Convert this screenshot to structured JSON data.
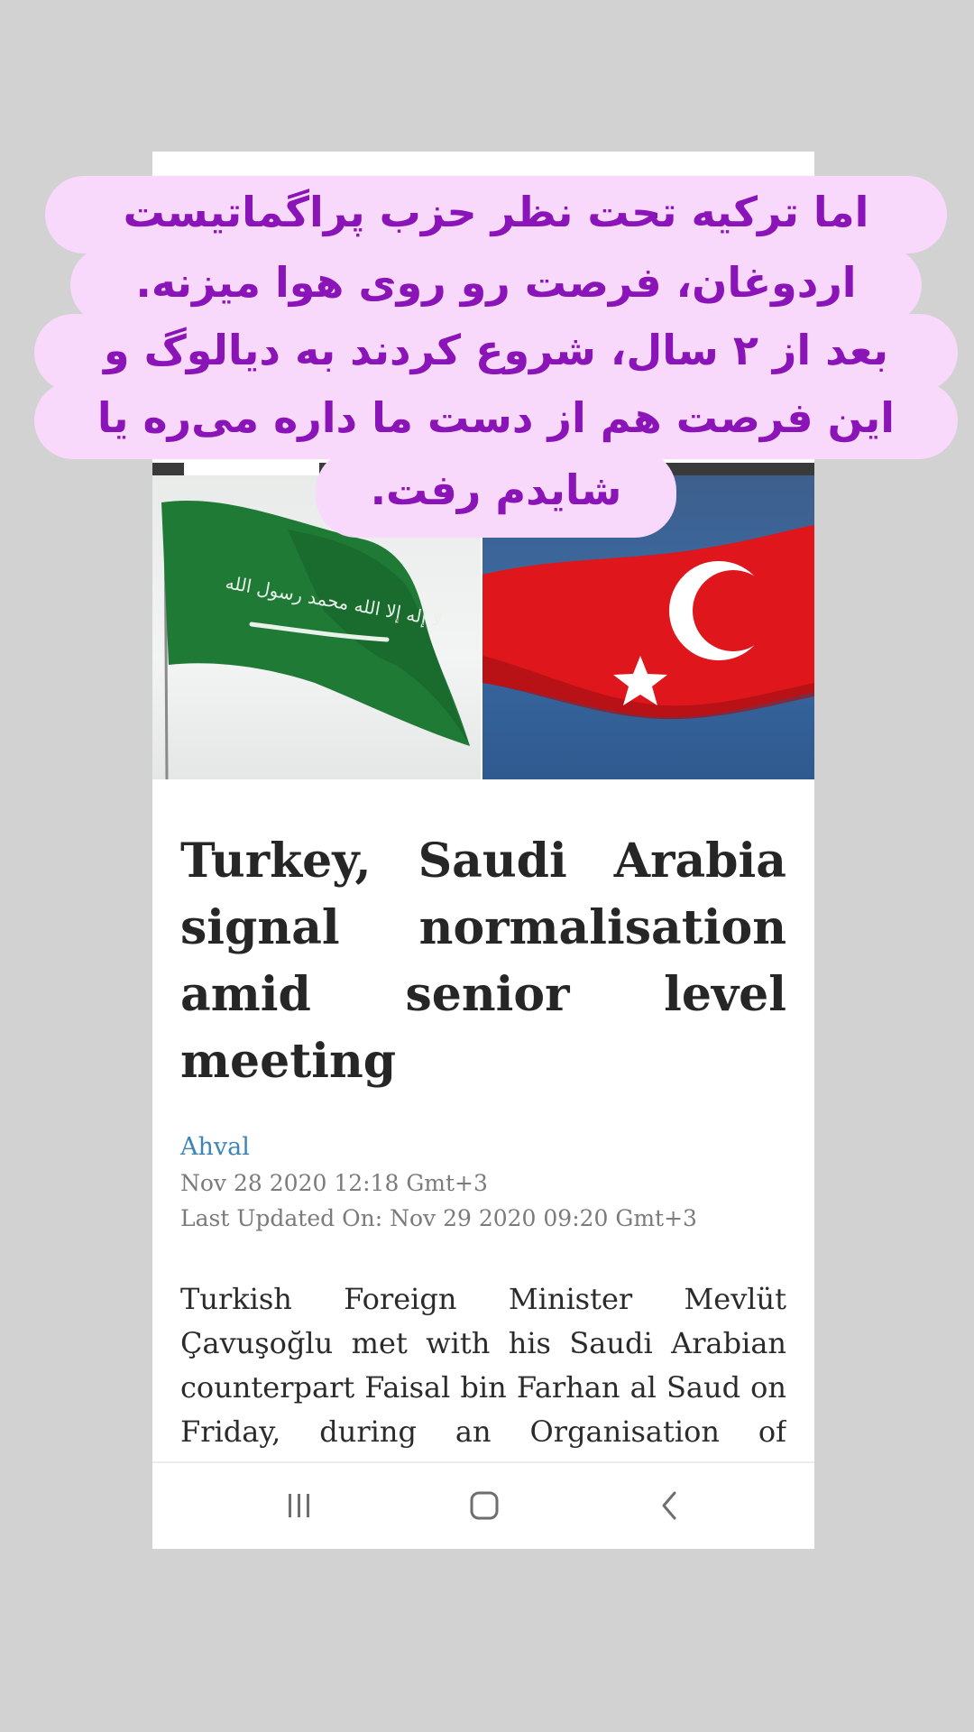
{
  "overlay": {
    "lines": [
      "اما ترکیه تحت نظر حزب پراگماتیست",
      "اردوغان، فرصت رو روی هوا میزنه.",
      "بعد از ۲ سال، شروع کردند به دیالوگ و",
      "این فرصت هم از دست ما داره می‌ره یا",
      "شایدم رفت."
    ]
  },
  "hero": {
    "left_flag_text": "لا إله إلا الله محمد رسول الله"
  },
  "article": {
    "headline": "Turkey, Saudi Arabia signal normalisation amid senior level meeting",
    "source": "Ahval",
    "published": "Nov 28 2020 12:18 Gmt+3",
    "updated": "Last Updated On: Nov 29 2020 09:20 Gmt+3",
    "body": "Turkish Foreign Minister Mevlüt Çavuşoğlu met with his Saudi Arabian counterpart Faisal bin Farhan al Saud on Friday, during an Organisation of"
  },
  "navbar": {
    "icons": [
      "recents-icon",
      "home-icon",
      "back-icon"
    ]
  },
  "colors": {
    "background": "#d2d2d2",
    "caption_bg": "#f8d9fb",
    "caption_text": "#8a14b8",
    "source_link": "#3c85b5",
    "saudi_green": "#1f7a36",
    "turkey_red": "#e0161d"
  }
}
